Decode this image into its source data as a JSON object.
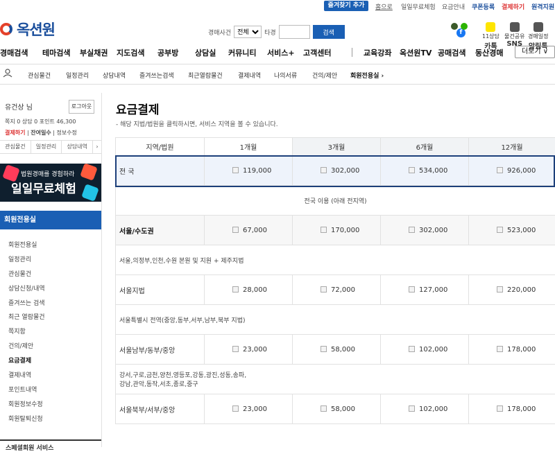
{
  "util": {
    "fav_label": "즐겨찾기 추가",
    "links": [
      "홈으로",
      "일일무료체험",
      "요금안내",
      "쿠폰등록",
      "결제하기",
      "원격지원"
    ]
  },
  "logo": {
    "text": "옥션원"
  },
  "search": {
    "label": "경매사건",
    "select_value": "전체",
    "label2": "타경",
    "button": "검색"
  },
  "right_icons": [
    {
      "top": "11상담",
      "label": "카톡"
    },
    {
      "top": "물건공유",
      "label": "SNS"
    },
    {
      "top": "경매일정",
      "label": "알림톡"
    }
  ],
  "main_nav": {
    "items": [
      "경매검색",
      "테마검색",
      "부실채권",
      "지도검색",
      "공부방",
      "상담실",
      "커뮤니티",
      "서비스+",
      "고객센터",
      "교육강좌",
      "옥션원TV",
      "공매검색",
      "동산경매"
    ],
    "more": "더보기 ∨"
  },
  "sub_nav": {
    "my": "MY",
    "items": [
      "관심물건",
      "일정관리",
      "상담내역",
      "즐겨쓰는검색",
      "최근열람물건",
      "결제내역",
      "나의서류",
      "건의/제안",
      "회원전용실 ›"
    ]
  },
  "sidebar": {
    "user": "유건상 님",
    "logout": "로그아웃",
    "stats": "쪽지 0  상담 0  포인트 46,300",
    "stats2_a": "결제하기",
    "stats2_b": "잔여일수",
    "stats2_c": "정보수정",
    "tabs": [
      "관심물건",
      "일정관리",
      "상담내역",
      "›"
    ],
    "banner_t1": "법원경매를 경험하라",
    "banner_t2": "일일무료체험",
    "section": "회원전용실",
    "menu": [
      "회원전용실",
      "일정관리",
      "관심물건",
      "상담신청/내역",
      "즐겨쓰는 검색",
      "최근 열람물건",
      "쪽지함",
      "건의/제안",
      "요금결제",
      "결제내역",
      "포인트내역",
      "회원정보수정",
      "회원탈퇴신청"
    ],
    "footer": "스페셜회원 서비스"
  },
  "content": {
    "title": "요금결제",
    "note": "- 해당 지법/법원을 클릭하시면, 서비스 지역을 볼 수 있습니다.",
    "headers": [
      "지역/법원",
      "1개월",
      "3개월",
      "6개월",
      "12개월"
    ],
    "rows": [
      {
        "type": "price",
        "region": "전 국",
        "prices": [
          "119,000",
          "302,000",
          "534,000",
          "926,000"
        ],
        "selected": true
      },
      {
        "type": "span",
        "text": "전국 이용 (아래 전지역)",
        "center": true
      },
      {
        "type": "price",
        "region": "서울/수도권",
        "prices": [
          "67,000",
          "170,000",
          "302,000",
          "523,000"
        ],
        "bold": true,
        "gray": true
      },
      {
        "type": "span",
        "text": "서울,의정부,인천,수원 본원 및 지원 + 제주지법"
      },
      {
        "type": "price",
        "region": "서울지법",
        "prices": [
          "28,000",
          "72,000",
          "127,000",
          "220,000"
        ]
      },
      {
        "type": "span",
        "text": "서울특별시 전역(중앙,동부,서부,남부,북부 지법)"
      },
      {
        "type": "price",
        "region": "서울남부/동부/중앙",
        "prices": [
          "23,000",
          "58,000",
          "102,000",
          "178,000"
        ]
      },
      {
        "type": "span",
        "text": "강서,구로,금천,양천,영등포,강동,광진,성동,송파,\n강남,관악,동작,서초,종로,중구"
      },
      {
        "type": "price",
        "region": "서울북부/서부/중앙",
        "prices": [
          "23,000",
          "58,000",
          "102,000",
          "178,000"
        ]
      }
    ]
  },
  "colors": {
    "accent": "#1a5fb4",
    "brand_red": "#e4412a",
    "select_border": "#1c3f7a"
  }
}
